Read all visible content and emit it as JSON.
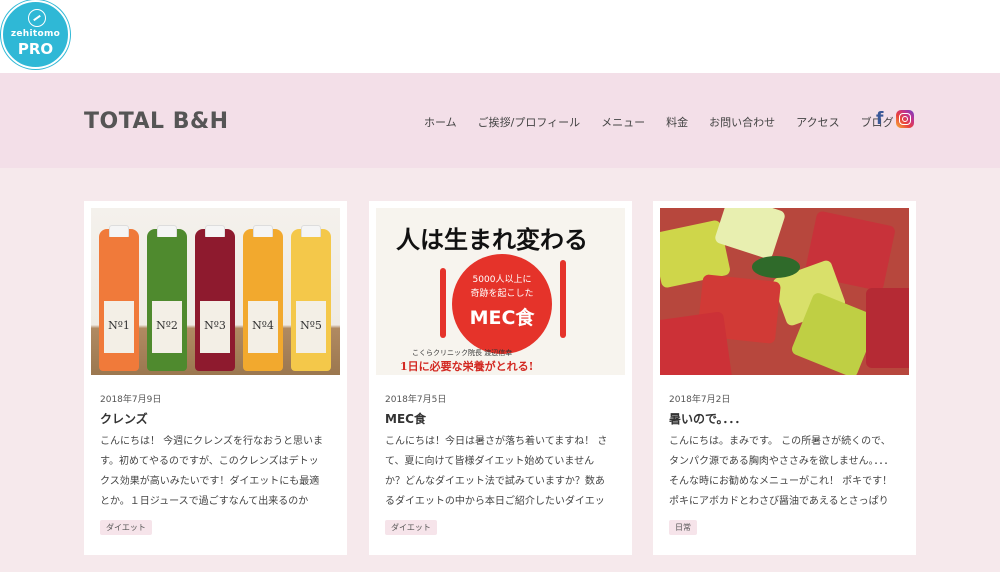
{
  "badge": {
    "word": "zehitomo",
    "pro": "PRO"
  },
  "site": {
    "title": "TOTAL B&H"
  },
  "nav": [
    "ホーム",
    "ご挨拶/プロフィール",
    "メニュー",
    "料金",
    "お問い合わせ",
    "アクセス",
    "ブログ"
  ],
  "social": {
    "facebook_glyph": "f",
    "icons": [
      "facebook-icon",
      "instagram-icon"
    ]
  },
  "posts": [
    {
      "date": "2018年7月9日",
      "title": "クレンズ",
      "excerpt": "こんにちは！ 今週にクレンズを行なおうと思います。初めてやるのですが、このクレンズはデトックス効果が高いみたいです！ダイエットにも最適とか。１日ジュースで過ごすなんて出来るのかな？と",
      "tag": "ダイエット",
      "bottle_labels": [
        "Nº1",
        "Nº2",
        "Nº3",
        "Nº4",
        "Nº5"
      ]
    },
    {
      "date": "2018年7月5日",
      "title": "MEC食",
      "excerpt": "こんにちは！今日は暑さが落ち着いてますね！ さて、夏に向けて皆様ダイエット始めていませんか？どんなダイエット法で試みていますか？数あるダイエットの中から本日ご紹介したいダイエットがMEC",
      "tag": "ダイエット",
      "book": {
        "headline": "人は生まれ変わる",
        "circle_line1": "5000人以上に",
        "circle_line2": "奇跡を起こした",
        "circle_line3": "MEC食",
        "author": "こくらクリニック院長 渡辺信幸",
        "bottom": "1日に必要な栄養がとれる!"
      }
    },
    {
      "date": "2018年7月2日",
      "title": "暑いので。．．．",
      "excerpt": "こんにちは。まみです。 この所暑さが続くので、タンパク源である胸肉やささみを欲しません。．．．そんな時にお勧めなメニューがこれ！ ポキです！ ポキにアボカドとわさび醤油であえるとさっぱり食べ",
      "tag": "日常"
    }
  ]
}
